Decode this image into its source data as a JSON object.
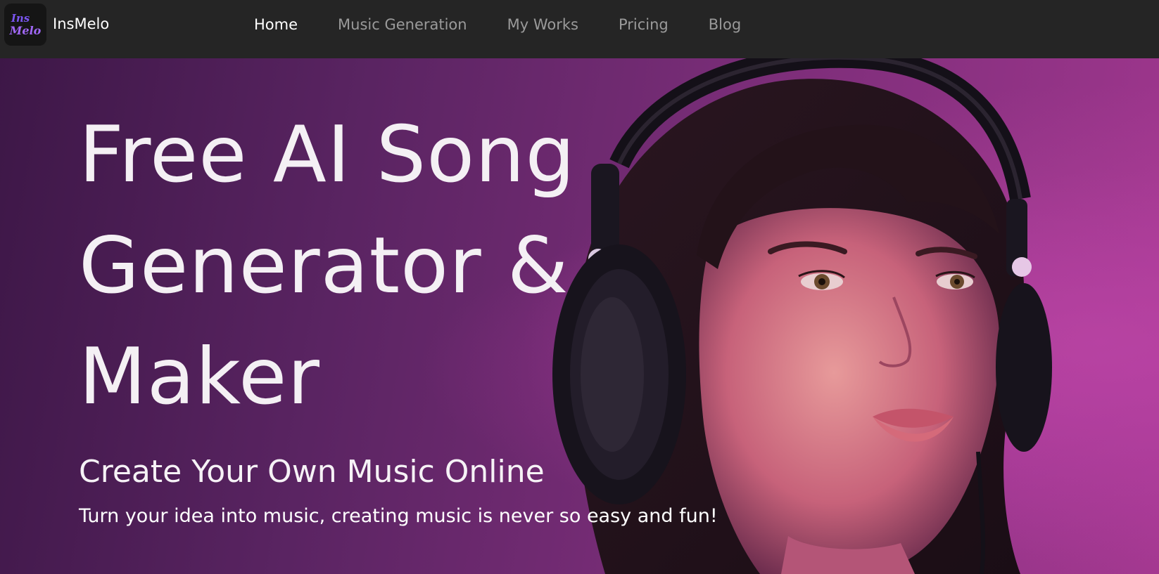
{
  "header": {
    "logo_line1": "Ins",
    "logo_line2": "Melo",
    "brand": "InsMelo",
    "nav": [
      {
        "label": "Home",
        "active": true
      },
      {
        "label": "Music Generation",
        "active": false
      },
      {
        "label": "My Works",
        "active": false
      },
      {
        "label": "Pricing",
        "active": false
      },
      {
        "label": "Blog",
        "active": false
      }
    ]
  },
  "hero": {
    "title": "Free AI Song Generator & Maker",
    "subtitle": "Create Your Own Music Online",
    "description": "Turn your idea into music, creating music is never so easy and fun!",
    "image_subject": "woman-with-headphones"
  },
  "colors": {
    "nav_bg": "#252525",
    "nav_active": "#ffffff",
    "nav_inactive": "#9a9a9a",
    "brand_accent": "#8e5cf7",
    "hero_purple": "#7a2d78"
  }
}
